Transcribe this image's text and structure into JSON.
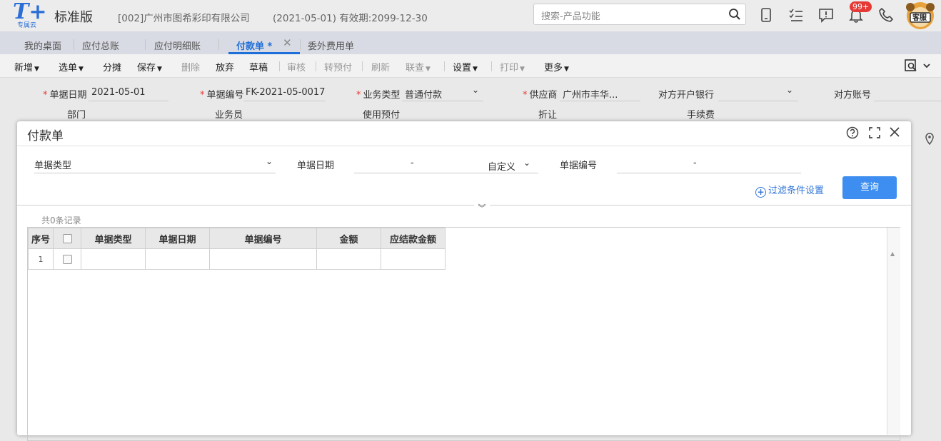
{
  "header": {
    "logo_text": "T+",
    "logo_sub": "专属云",
    "edition": "标准版",
    "company": "[002]广州市图希彩印有限公司",
    "period": "(2021-05-01)  有效期:2099-12-30",
    "search_placeholder": "搜索-产品功能",
    "notification_badge": "99+",
    "avatar_label": "客服"
  },
  "tabs": [
    "我的桌面",
    "应付总账",
    "应付明细账",
    "付款单 *",
    "委外费用单"
  ],
  "active_tab": "付款单 *",
  "toolbar": {
    "new": "新增",
    "select": "选单",
    "allocate": "分摊",
    "save": "保存",
    "delete": "删除",
    "abandon": "放弃",
    "draft": "草稿",
    "audit": "审核",
    "prepay": "转预付",
    "refresh": "刷新",
    "link": "联查",
    "settings": "设置",
    "print": "打印",
    "more": "更多"
  },
  "form": {
    "date_label": "单据日期",
    "date_value": "2021-05-01",
    "code_label": "单据编号",
    "code_value": "FK-2021-05-0017",
    "biztype_label": "业务类型",
    "biztype_value": "普通付款",
    "supplier_label": "供应商",
    "supplier_value": "广州市丰华...",
    "bank_label": "对方开户银行",
    "account_label": "对方账号",
    "dept_label": "部门",
    "staff_label": "业务员",
    "prepay_label": "使用预付",
    "discount_label": "折让",
    "fee_label": "手续费"
  },
  "modal": {
    "title": "付款单",
    "filter_type_label": "单据类型",
    "filter_date_label": "单据日期",
    "date_sep": "-",
    "custom_label": "自定义",
    "filter_code_label": "单据编号",
    "code_sep": "-",
    "filter_settings": "过滤条件设置",
    "query_button": "查询",
    "record_count": "共0条记录",
    "columns": [
      "序号",
      "单据类型",
      "单据日期",
      "单据编号",
      "金额",
      "应结款金额"
    ],
    "rows": [
      {
        "index": "1",
        "type": "",
        "date": "",
        "code": "",
        "amount": "",
        "settle": ""
      }
    ]
  }
}
